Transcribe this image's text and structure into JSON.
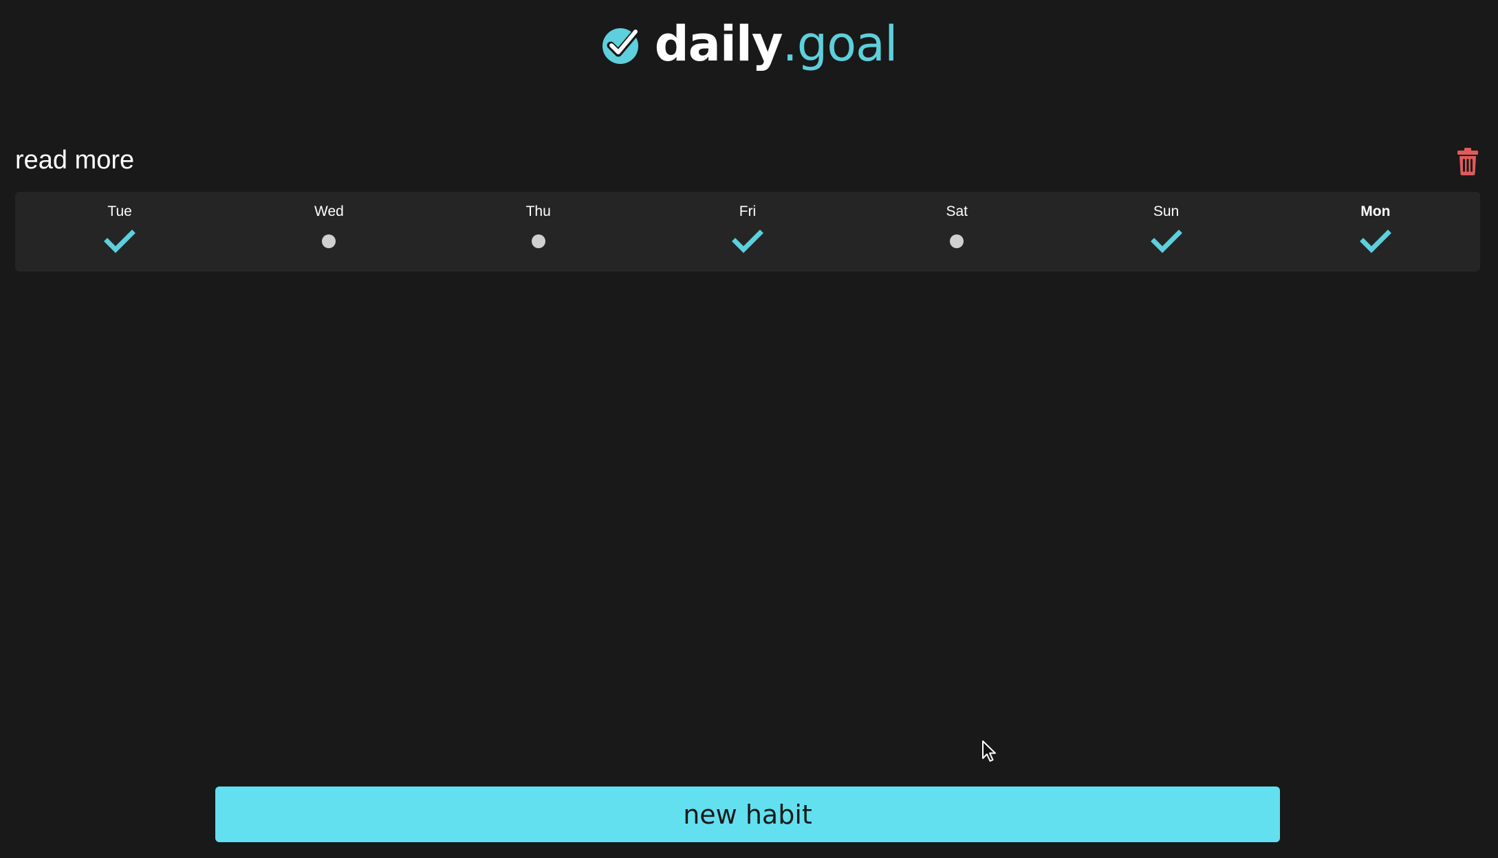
{
  "brand": {
    "name_bold": "daily",
    "name_light": ".goal",
    "logo_icon": "check-circle-icon",
    "accent_color": "#5ecfdc"
  },
  "habit": {
    "title": "read more",
    "delete_icon": "trash-icon",
    "delete_color": "#e05a5a",
    "days": [
      {
        "label": "Tue",
        "status": "done"
      },
      {
        "label": "Wed",
        "status": "empty"
      },
      {
        "label": "Thu",
        "status": "empty"
      },
      {
        "label": "Fri",
        "status": "done"
      },
      {
        "label": "Sat",
        "status": "empty"
      },
      {
        "label": "Sun",
        "status": "done"
      },
      {
        "label": "Mon",
        "status": "done",
        "today": true
      }
    ]
  },
  "actions": {
    "new_habit_label": "new habit",
    "button_color": "#62e0f0"
  }
}
